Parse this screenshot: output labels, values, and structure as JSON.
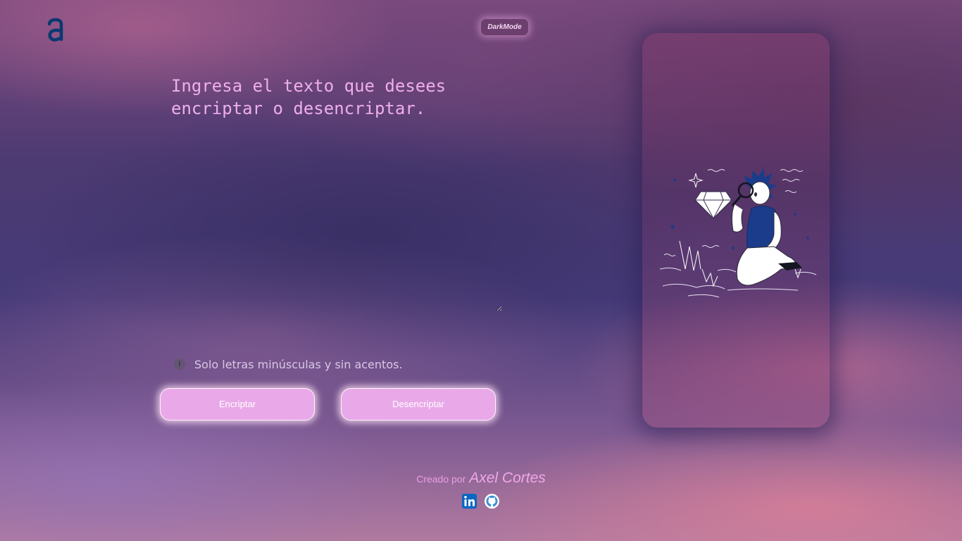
{
  "header": {
    "logo_letter": "a",
    "darkmode_label": "DarkMode"
  },
  "editor": {
    "placeholder": "Ingresa el texto que desees encriptar o desencriptar.",
    "value": ""
  },
  "notice": {
    "icon": "info-icon",
    "text": "Solo letras minúsculas y sin acentos."
  },
  "actions": {
    "encrypt_label": "Encriptar",
    "decrypt_label": "Desencriptar"
  },
  "result_panel": {
    "illustration": "person-inspecting-diamond-illustration"
  },
  "footer": {
    "credit_prefix": "Creado por",
    "credit_name": "Axel Cortes",
    "social": [
      {
        "icon": "linkedin-icon"
      },
      {
        "icon": "github-icon"
      }
    ]
  },
  "colors": {
    "accent": "#e9a9e8",
    "text_pink": "#efaeea",
    "logo_blue": "#0a3871",
    "darkmode_bg": "#6c3f6e"
  }
}
